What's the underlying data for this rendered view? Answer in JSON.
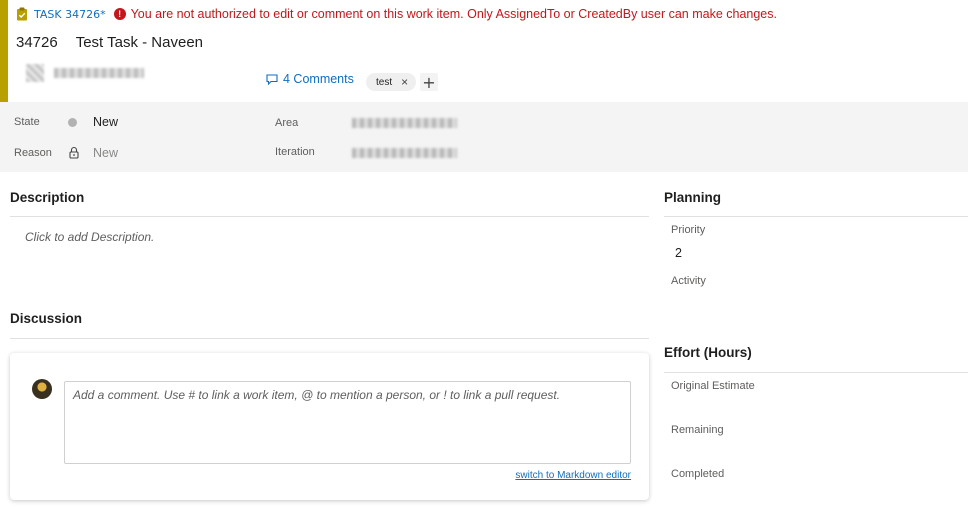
{
  "header": {
    "type_link": "TASK 34726*",
    "error_message": "You are not authorized to edit or comment on this work item. Only AssignedTo or CreatedBy user can make changes.",
    "id": "34726",
    "title": "Test Task - Naveen",
    "comments_label": "4 Comments",
    "tags": [
      "test"
    ],
    "tag_remove_glyph": "×",
    "add_tag_glyph": "+"
  },
  "fields": {
    "state_label": "State",
    "state_value": "New",
    "reason_label": "Reason",
    "reason_value": "New",
    "area_label": "Area",
    "iteration_label": "Iteration"
  },
  "description": {
    "title": "Description",
    "placeholder": "Click to add Description."
  },
  "discussion": {
    "title": "Discussion",
    "comment_placeholder": "Add a comment. Use # to link a work item, @ to mention a person, or ! to link a pull request.",
    "markdown_link": "switch to Markdown editor"
  },
  "planning": {
    "title": "Planning",
    "priority_label": "Priority",
    "priority_value": "2",
    "activity_label": "Activity"
  },
  "effort": {
    "title": "Effort (Hours)",
    "original_estimate_label": "Original Estimate",
    "remaining_label": "Remaining",
    "completed_label": "Completed"
  },
  "colors": {
    "accent": "#b8a000",
    "link": "#106ebe",
    "error": "#c4161c"
  },
  "icons": {
    "type": "task-clipboard-icon",
    "error": "error-icon",
    "comments": "chat-icon",
    "reason": "lock-icon"
  }
}
